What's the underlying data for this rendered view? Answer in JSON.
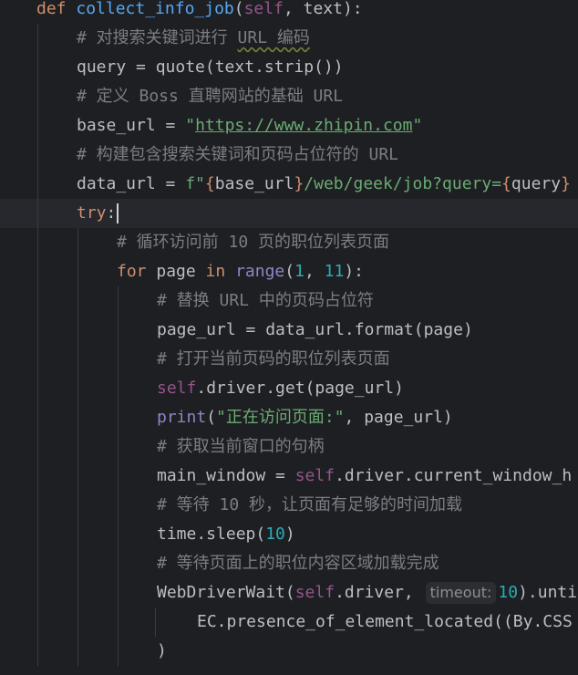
{
  "code": {
    "l1": {
      "kw": "def",
      "fn": "collect_info_job",
      "p_open": "(",
      "self": "self",
      "rest": ", text):"
    },
    "l2": {
      "comment_prefix": "# 对搜索关键词进行 ",
      "squiggle": "URL 编码"
    },
    "l3": {
      "text": "query = quote(text.strip())"
    },
    "l4": {
      "comment": "# 定义 Boss 直聘网站的基础 URL"
    },
    "l5": {
      "pre": "base_url = ",
      "q1": "\"",
      "url": "https://www.zhipin.com",
      "q2": "\""
    },
    "l6": {
      "comment": "# 构建包含搜索关键词和页码占位符的 URL"
    },
    "l7": {
      "pre": "data_url = ",
      "f": "f\"",
      "b1": "{",
      "v1": "base_url",
      "b2": "}",
      "mid": "/web/geek/job?query=",
      "b3": "{",
      "v2": "query",
      "b4": "}"
    },
    "l8": {
      "kw": "try",
      "colon": ":"
    },
    "l9": {
      "comment": "# 循环访问前 10 页的职位列表页面"
    },
    "l10": {
      "kw_for": "for",
      "sp1": " page ",
      "kw_in": "in",
      "sp2": " ",
      "bi": "range",
      "p1": "(",
      "n1": "1",
      "c": ", ",
      "n2": "11",
      "p2": "):"
    },
    "l11": {
      "comment": "# 替换 URL 中的页码占位符"
    },
    "l12": {
      "text": "page_url = data_url.format(page)"
    },
    "l13": {
      "comment": "# 打开当前页码的职位列表页面"
    },
    "l14": {
      "self": "self",
      "rest": ".driver.get(page_url)"
    },
    "l15": {
      "bi": "print",
      "p1": "(",
      "str": "\"正在访问页面:\"",
      "rest": ", page_url)"
    },
    "l16": {
      "comment": "# 获取当前窗口的句柄"
    },
    "l17": {
      "pre": "main_window = ",
      "self": "self",
      "rest": ".driver.current_window_h"
    },
    "l18": {
      "comment": "# 等待 10 秒，让页面有足够的时间加载"
    },
    "l19": {
      "pre": "time.sleep(",
      "num": "10",
      "post": ")"
    },
    "l20": {
      "comment": "# 等待页面上的职位内容区域加载完成"
    },
    "l21": {
      "pre": "WebDriverWait(",
      "self": "self",
      "mid": ".driver, ",
      "hint": "timeout:",
      "num": "10",
      "post": ").unti"
    },
    "l22": {
      "text": "EC.presence_of_element_located((By.CSS"
    },
    "l23": {
      "text": ")"
    }
  },
  "colors": {
    "background": "#1e1f22",
    "keyword": "#cf8e6d",
    "function": "#56a8f5",
    "self": "#94558d",
    "string": "#6aab73",
    "number": "#2aacb8",
    "comment": "#7a7e85"
  }
}
